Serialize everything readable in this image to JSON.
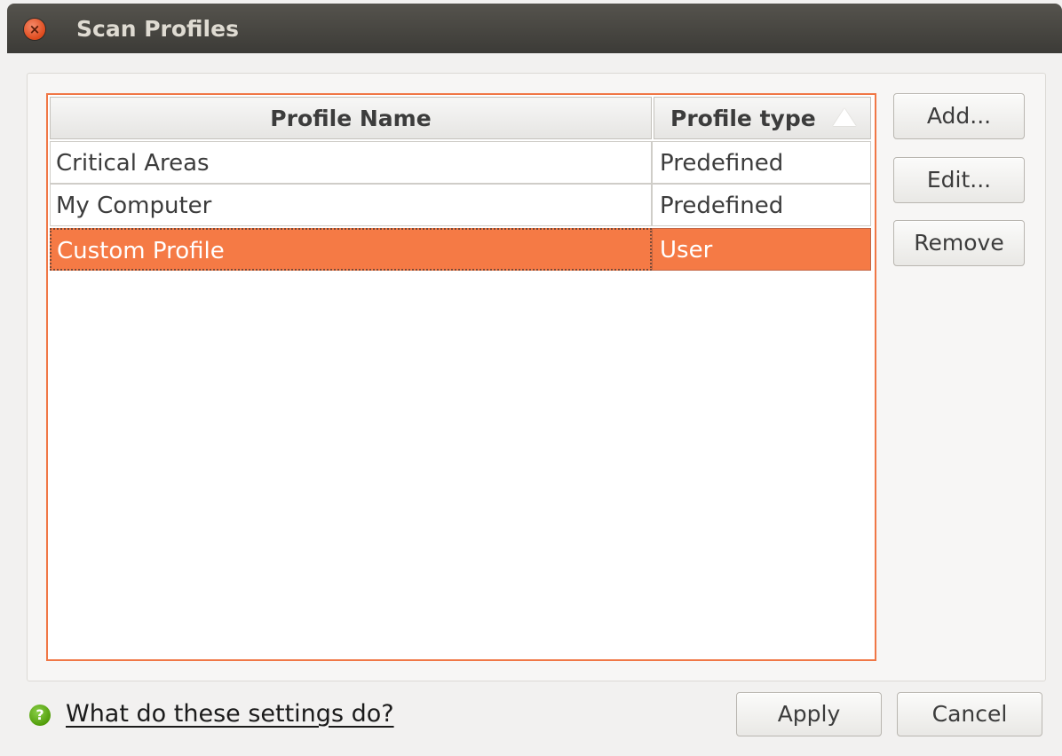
{
  "window": {
    "title": "Scan Profiles",
    "close_glyph": "×"
  },
  "table": {
    "columns": [
      {
        "label": "Profile Name"
      },
      {
        "label": "Profile type",
        "sort_indicator": "ascending"
      }
    ],
    "rows": [
      {
        "name": "Critical Areas",
        "type": "Predefined",
        "selected": false
      },
      {
        "name": "My Computer",
        "type": "Predefined",
        "selected": false
      },
      {
        "name": "Custom Profile",
        "type": "User",
        "selected": true
      }
    ]
  },
  "side_buttons": {
    "add_label": "Add...",
    "edit_label": "Edit...",
    "remove_label": "Remove"
  },
  "footer": {
    "help_icon_glyph": "?",
    "help_link_label": "What do these settings do?",
    "apply_label": "Apply",
    "cancel_label": "Cancel"
  },
  "colors": {
    "selection": "#f57a45",
    "focus_border": "#f07746",
    "titlebar": "#3c3b37"
  }
}
